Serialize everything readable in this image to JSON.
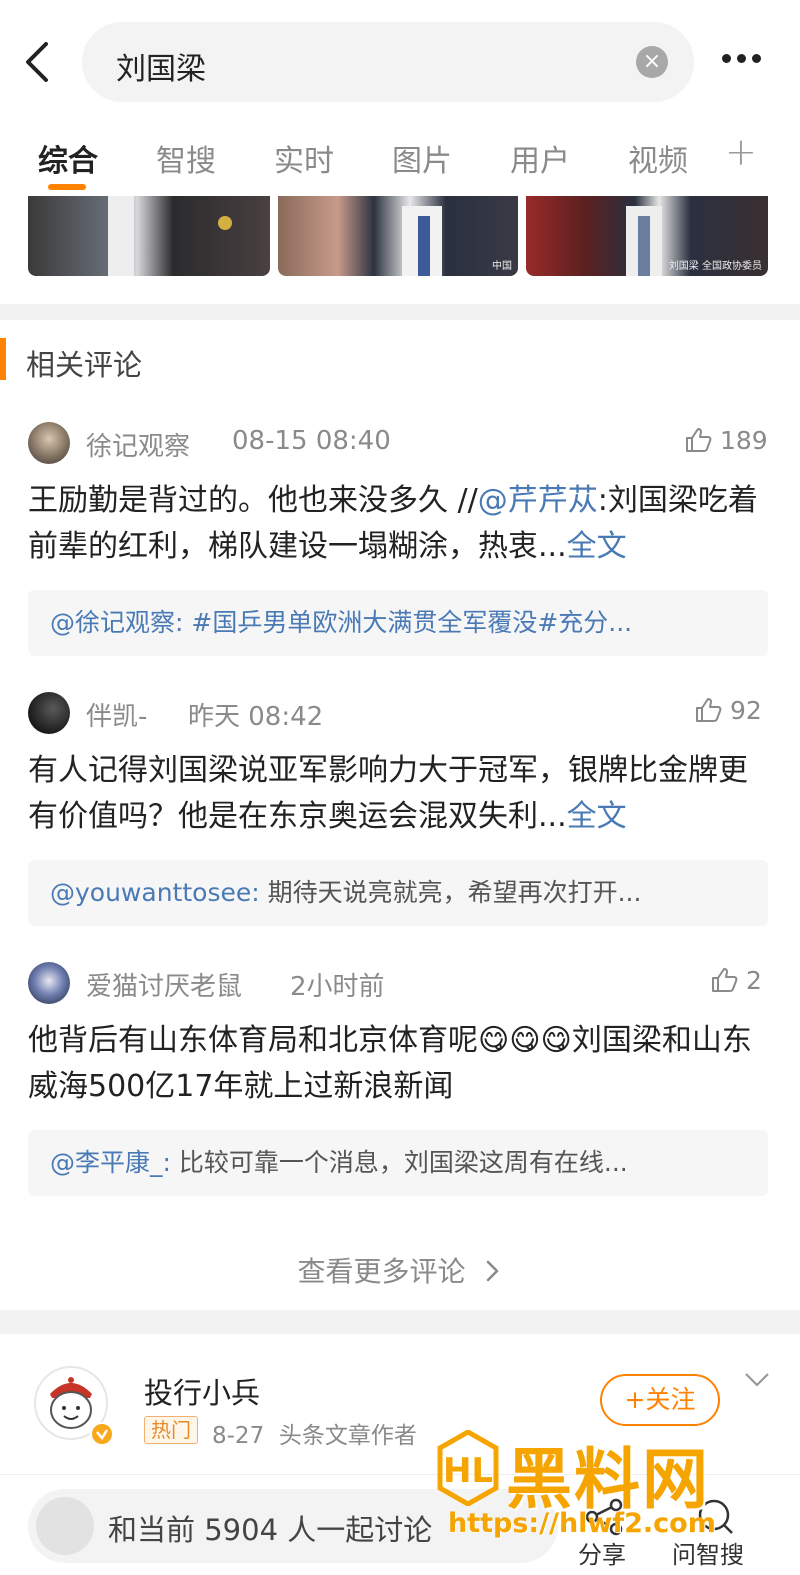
{
  "search": {
    "query": "刘国梁"
  },
  "tabs": [
    {
      "label": "综合",
      "active": true
    },
    {
      "label": "智搜"
    },
    {
      "label": "实时"
    },
    {
      "label": "图片"
    },
    {
      "label": "用户"
    },
    {
      "label": "视频"
    }
  ],
  "images": {
    "watermark_2": "中国",
    "watermark_3": "刘国梁 全国政协委员"
  },
  "related_comments": {
    "title": "相关评论",
    "items": [
      {
        "user": "徐记观察",
        "time": "08-15 08:40",
        "likes": "189",
        "text_before": "王励勤是背过的。他也来没多久 //",
        "mention": "@芹芹苁",
        "text_after": ":刘国梁吃着前辈的红利，梯队建设一塌糊涂，热衷...",
        "full_text_link": "全文",
        "quote_user": "@徐记观察:",
        "quote_text": " #国乒男单欧洲大满贯全军覆没#充分..."
      },
      {
        "user": "伴凯-",
        "time": "昨天 08:42",
        "likes": "92",
        "text": "有人记得刘国梁说亚军影响力大于冠军，银牌比金牌更有价值吗？他是在东京奥运会混双失利...",
        "full_text_link": "全文",
        "quote_user": "@youwanttosee:",
        "quote_text": " 期待天说亮就亮，希望再次打开..."
      },
      {
        "user": "爱猫讨厌老鼠",
        "time": "2小时前",
        "likes": "2",
        "text_before": "他背后有山东体育局和北京体育呢",
        "emojis": "😋😋😋",
        "text_after": "刘国梁和山东威海500亿17年就上过新浪新闻",
        "quote_user": "@李平康_:",
        "quote_text": " 比较可靠一个消息，刘国梁这周有在线..."
      }
    ],
    "more_label": "查看更多评论"
  },
  "post": {
    "author": "投行小兵",
    "hot_badge": "热门",
    "date": "8-27",
    "role": "头条文章作者",
    "follow_label": "+关注"
  },
  "bottom_bar": {
    "discuss_text": "和当前 5904 人一起讨论",
    "share_label": "分享",
    "ask_label": "问智搜"
  },
  "watermark": {
    "text": "黑料网",
    "url": "https://hlwf2.com"
  },
  "colors": {
    "accent": "#ff8200",
    "link": "#4a7ab5"
  }
}
